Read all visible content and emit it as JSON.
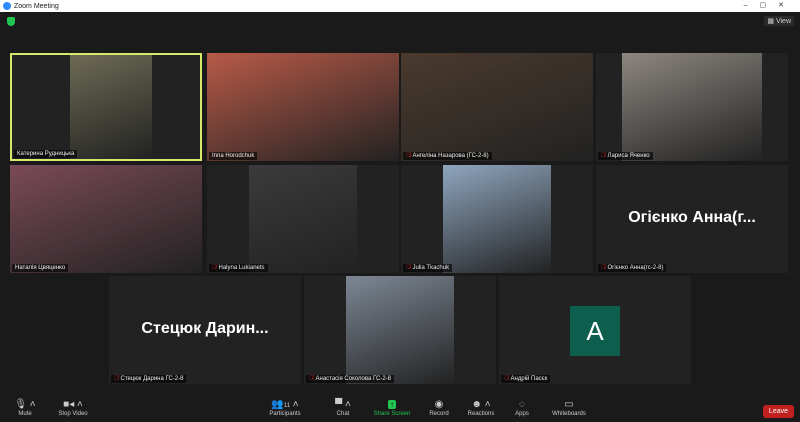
{
  "window": {
    "title": "Zoom Meeting",
    "view_label": "View"
  },
  "tiles": [
    {
      "name": "Катерина Рудницька",
      "muted": false,
      "active": true,
      "type": "video",
      "color": "#6d6a54"
    },
    {
      "name": "Inna Horodchuk",
      "muted": false,
      "type": "video",
      "color": "#b85a48"
    },
    {
      "name": "Ангеліна Назарова (ГС-2-8)",
      "muted": true,
      "type": "video",
      "color": "#4a3a2e"
    },
    {
      "name": "Лариса Яченко",
      "muted": true,
      "type": "video",
      "color": "#8c8680"
    },
    {
      "name": "Наталія Цвяценко",
      "muted": false,
      "type": "video",
      "color": "#7a4a56"
    },
    {
      "name": "Halyna Lukianets",
      "muted": true,
      "type": "video",
      "color": "#3c3a3c"
    },
    {
      "name": "Julia Tkachuk",
      "muted": true,
      "type": "video",
      "color": "#8fa6bf"
    },
    {
      "name": "Огієнко Анна(гс-2-8)",
      "muted": true,
      "type": "text",
      "big": "Огієнко Анна(г..."
    },
    {
      "name": "Стецюк Дарина ГС-2-8",
      "muted": true,
      "type": "text",
      "big": "Стецюк  Дарин..."
    },
    {
      "name": "Анастасія Соколова ГС-2-8",
      "muted": true,
      "type": "video",
      "color": "#7d8794"
    },
    {
      "name": "Андрій Пасєк",
      "muted": true,
      "type": "avatar",
      "initial": "A"
    }
  ],
  "toolbar": {
    "mute": "Mute",
    "stop_video": "Stop Video",
    "participants": "Participants",
    "participant_count": "11",
    "chat": "Chat",
    "share_screen": "Share Screen",
    "record": "Record",
    "reactions": "Reactions",
    "apps": "Apps",
    "whiteboards": "Whiteboards",
    "leave": "Leave"
  }
}
